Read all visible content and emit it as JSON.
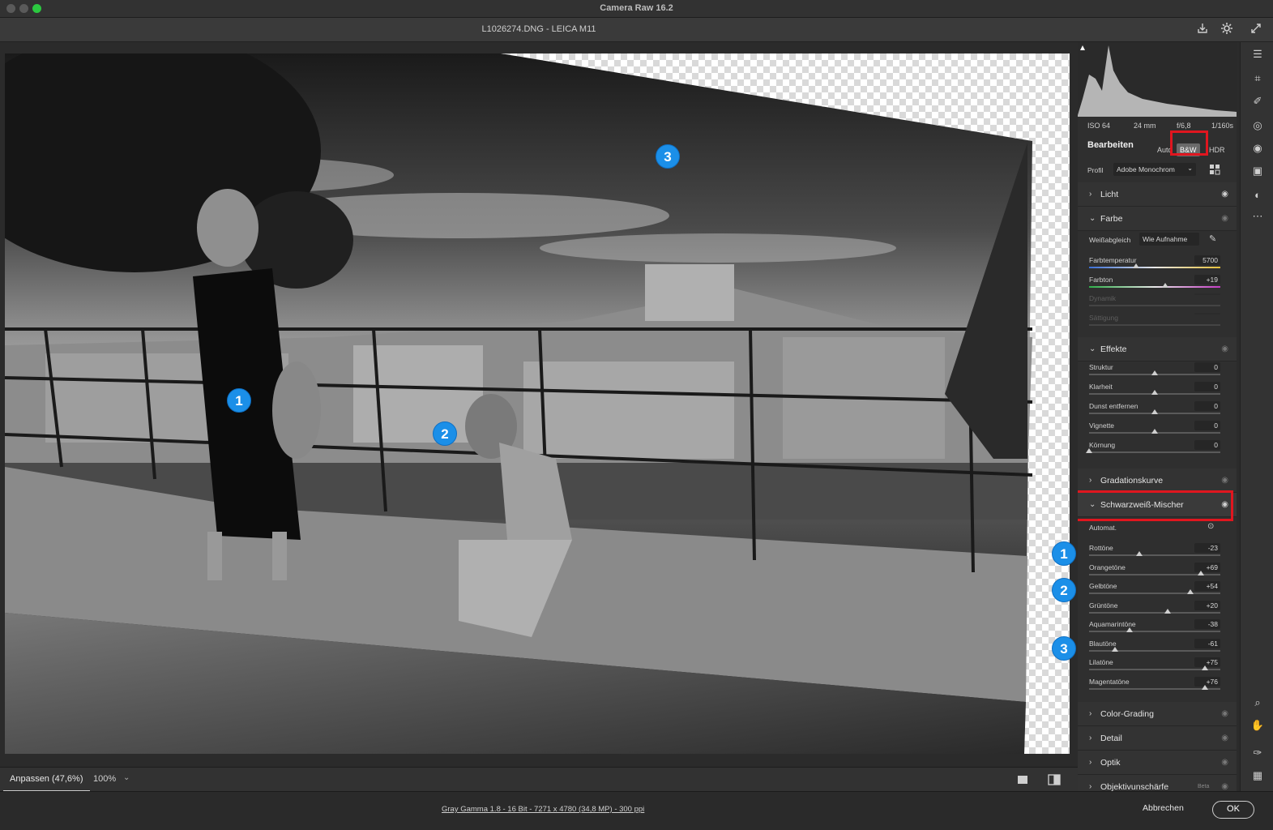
{
  "window": {
    "app_title": "Camera Raw 16.2",
    "file_title": "L1026274.DNG  -  LEICA M11",
    "traffic_colors": [
      "#5a5a5a",
      "#5a5a5a",
      "#2bc840"
    ]
  },
  "toolbar_icons": [
    "save-icon",
    "gear-icon",
    "expand-icon"
  ],
  "canvas": {
    "badges": [
      "1",
      "2",
      "3"
    ],
    "side_badges": [
      "1",
      "2",
      "3"
    ]
  },
  "bottom": {
    "fit_label": "Anpassen (47,6%)",
    "zoom_value": "100%",
    "zoom_caret": "⌄"
  },
  "footer": {
    "info": "Gray Gamma 1.8 - 16 Bit - 7271 x 4780 (34,8 MP) - 300 ppi",
    "cancel": "Abbrechen",
    "ok": "OK"
  },
  "exif": {
    "iso": "ISO 64",
    "focal": "24 mm",
    "aperture": "f/6,8",
    "shutter": "1/160s"
  },
  "edit": {
    "title": "Bearbeiten",
    "modes": [
      "Auto",
      "B&W",
      "HDR"
    ],
    "profile_label": "Profil",
    "profile_value": "Adobe Monochrom"
  },
  "sections": {
    "licht": "Licht",
    "farbe": "Farbe",
    "effekte": "Effekte",
    "gradation": "Gradationskurve",
    "bw_mixer": "Schwarzweiß-Mischer",
    "color_grading": "Color-Grading",
    "detail": "Detail",
    "optik": "Optik",
    "lens": "Objektivunschärfe",
    "lens_badge": "Beta"
  },
  "farbe": {
    "wb_label": "Weißabgleich",
    "wb_value": "Wie Aufnahme",
    "sliders": [
      {
        "label": "Farbtemperatur",
        "value": "5700",
        "pos": 0.36
      },
      {
        "label": "Farbton",
        "value": "+19",
        "pos": 0.58
      },
      {
        "label": "Dynamik",
        "value": "",
        "pos": 0.5
      },
      {
        "label": "Sättigung",
        "value": "",
        "pos": 0.5
      }
    ]
  },
  "effekte": {
    "sliders": [
      {
        "label": "Struktur",
        "value": "0",
        "pos": 0.5
      },
      {
        "label": "Klarheit",
        "value": "0",
        "pos": 0.5
      },
      {
        "label": "Dunst entfernen",
        "value": "0",
        "pos": 0.5
      },
      {
        "label": "Vignette",
        "value": "0",
        "pos": 0.5
      },
      {
        "label": "Körnung",
        "value": "0",
        "pos": 0.0
      }
    ]
  },
  "bw_mixer": {
    "auto_label": "Automat.",
    "sliders": [
      {
        "label": "Rottöne",
        "value": "-23",
        "pos": 0.38
      },
      {
        "label": "Orangetöne",
        "value": "+69",
        "pos": 0.85
      },
      {
        "label": "Gelbtöne",
        "value": "+54",
        "pos": 0.77
      },
      {
        "label": "Grüntöne",
        "value": "+20",
        "pos": 0.6
      },
      {
        "label": "Aquamarintöne",
        "value": "-38",
        "pos": 0.31
      },
      {
        "label": "Blautöne",
        "value": "-61",
        "pos": 0.2
      },
      {
        "label": "Lilatöne",
        "value": "+75",
        "pos": 0.88
      },
      {
        "label": "Magentatöne",
        "value": "+76",
        "pos": 0.88
      }
    ]
  },
  "tools": [
    "edit-icon",
    "crop-icon",
    "heal-icon",
    "mask-icon",
    "redeye-icon",
    "presets-icon",
    "snapshot-icon",
    "more-icon",
    "zoom-icon",
    "hand-icon",
    "sampler-icon",
    "grid-icon"
  ]
}
